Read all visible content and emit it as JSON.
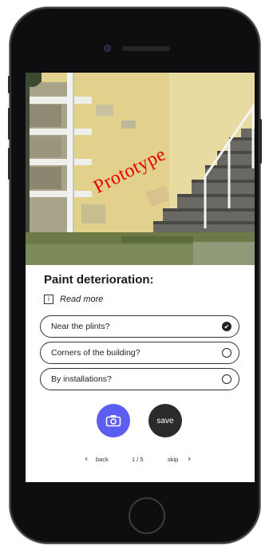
{
  "watermark": "Prototype",
  "question": {
    "title": "Paint deterioration:",
    "read_more": "Read more"
  },
  "options": [
    {
      "label": "Near the plints?",
      "selected": true
    },
    {
      "label": "Corners of the building?",
      "selected": false
    },
    {
      "label": "By installations?",
      "selected": false
    }
  ],
  "actions": {
    "camera_icon": "camera-icon",
    "save_label": "save"
  },
  "pager": {
    "back_label": "back",
    "position": "1 / 5",
    "skip_label": "skip"
  },
  "colors": {
    "accent": "#5b5ef0",
    "save_button": "#2b2b2b",
    "watermark": "#e60000"
  }
}
